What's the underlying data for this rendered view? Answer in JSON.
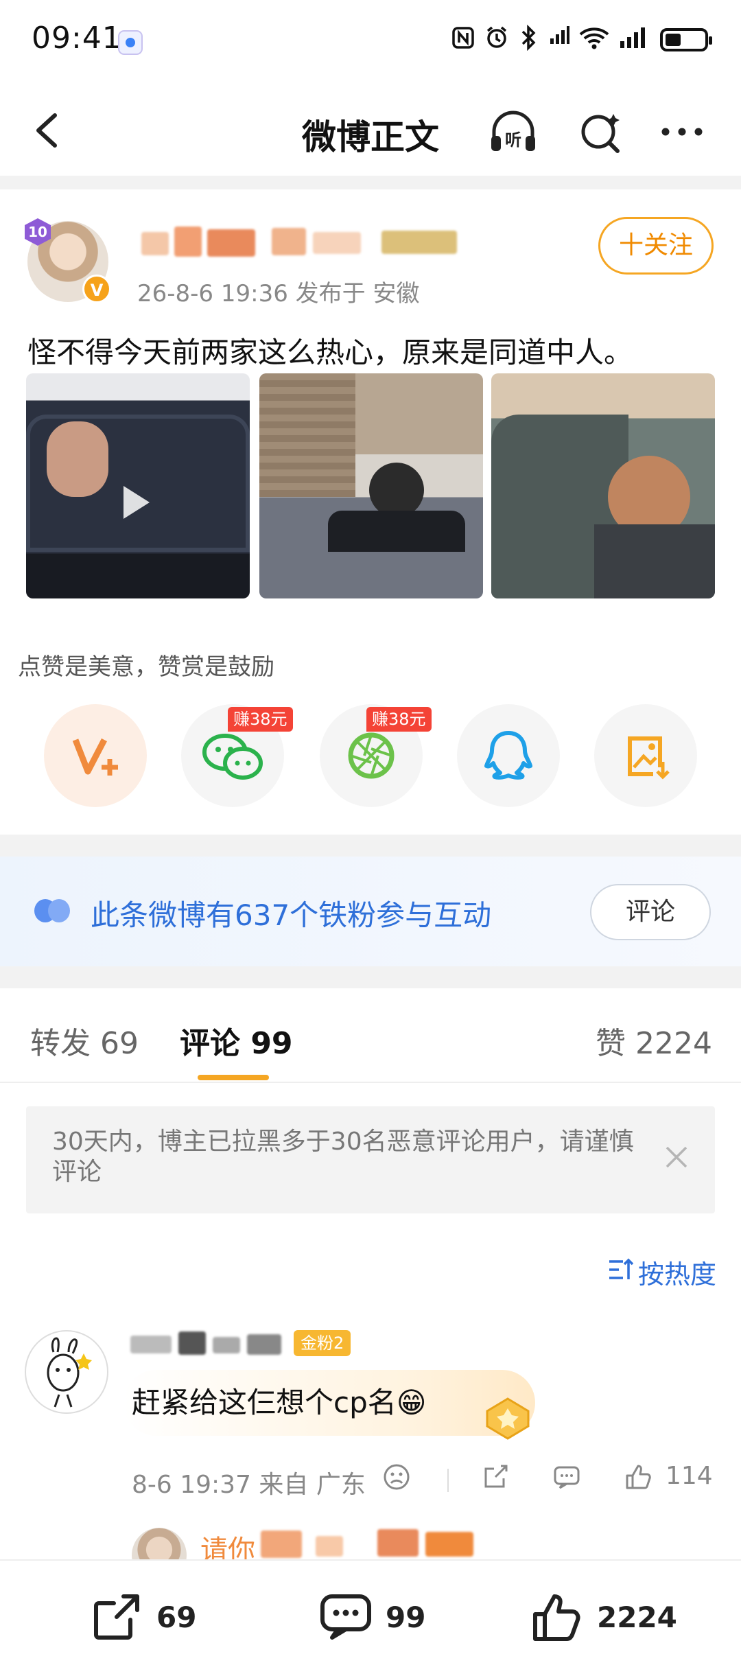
{
  "status_bar": {
    "time": "09:41"
  },
  "nav": {
    "title": "微博正文"
  },
  "post": {
    "level": "10",
    "verified_mark": "V",
    "meta": "26-8-6 19:36  发布于 安徽",
    "follow_label": "十关注",
    "text": "怪不得今天前两家这么热心，原来是同道中人。",
    "image_count": 3
  },
  "reward_tip": "点赞是美意，赞赏是鼓励",
  "share": {
    "earn_badges": [
      "赚38元",
      "赚38元"
    ],
    "icons": [
      "vplus-icon",
      "wechat-icon",
      "moments-icon",
      "qq-icon",
      "save-image-icon"
    ]
  },
  "fans_banner": {
    "text": "此条微博有637个铁粉参与互动",
    "button": "评论"
  },
  "tabs": {
    "repost": "转发 69",
    "comment": "评论 99",
    "like": "赞 2224"
  },
  "notice": {
    "text": "30天内，博主已拉黑多于30名恶意评论用户，请谨慎评论"
  },
  "sort_label": "按热度",
  "comment": {
    "fan_badge": "金粉2",
    "text": "赶紧给这仨想个cp名😁",
    "meta": "8-6 19:37  来自 广东",
    "likes": "114",
    "reply_preview": "请你"
  },
  "bottom_bar": {
    "reposts": "69",
    "comments": "99",
    "likes": "2224"
  },
  "colors": {
    "accent": "#f5a623",
    "link": "#2e6fd9",
    "earn": "#f44336"
  }
}
